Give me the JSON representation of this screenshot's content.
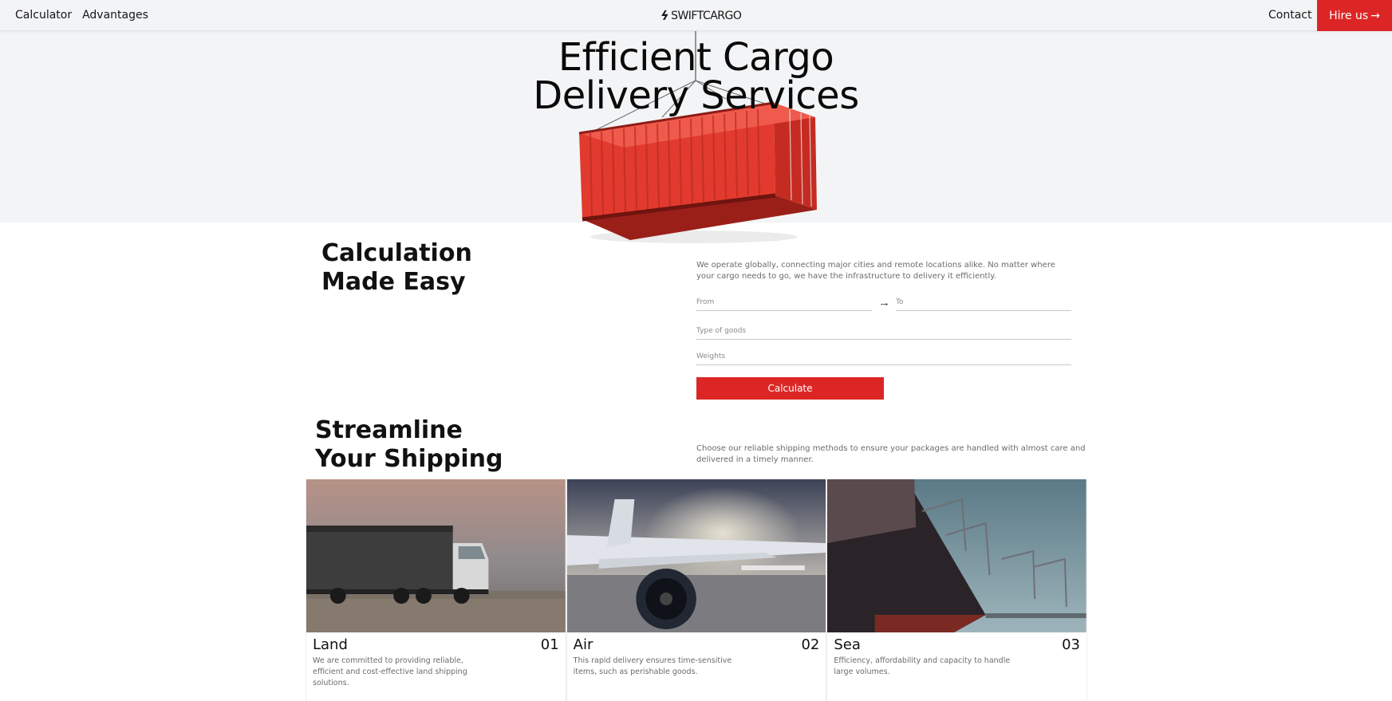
{
  "nav": {
    "links": [
      "Calculator",
      "Advantages"
    ],
    "logo_text": "SWIFTCARGO",
    "contact": "Contact",
    "hire_label": "Hire us",
    "hire_arrow": "→"
  },
  "hero": {
    "title_line1": "Efficient Cargo",
    "title_line2": "Delivery Services"
  },
  "calculation": {
    "title_line1": "Calculation",
    "title_line2": "Made Easy",
    "description": "We operate globally, connecting major cities and remote locations alike. No matter where your cargo needs to go, we have the infrastructure to delivery it efficiently.",
    "from_placeholder": "From",
    "to_placeholder": "To",
    "arrow": "→",
    "goods_placeholder": "Type of goods",
    "weights_placeholder": "Weights",
    "button_label": "Calculate"
  },
  "streamline": {
    "title_line1": "Streamline",
    "title_line2": "Your Shipping",
    "description": "Choose our reliable shipping methods to ensure your packages are handled with almost care and delivered in a timely manner."
  },
  "cards": [
    {
      "name": "Land",
      "number": "01",
      "description": "We are committed to providing reliable, efficient and cost-effective land shipping solutions."
    },
    {
      "name": "Air",
      "number": "02",
      "description": "This rapid delivery ensures time-sensitive items, such as perishable goods."
    },
    {
      "name": "Sea",
      "number": "03",
      "description": "Efficiency, affordability and capacity to handle large volumes."
    }
  ],
  "colors": {
    "accent": "#dc2626",
    "hero_bg": "#f3f4f6",
    "text": "#111111",
    "muted": "#6b6b6b"
  }
}
